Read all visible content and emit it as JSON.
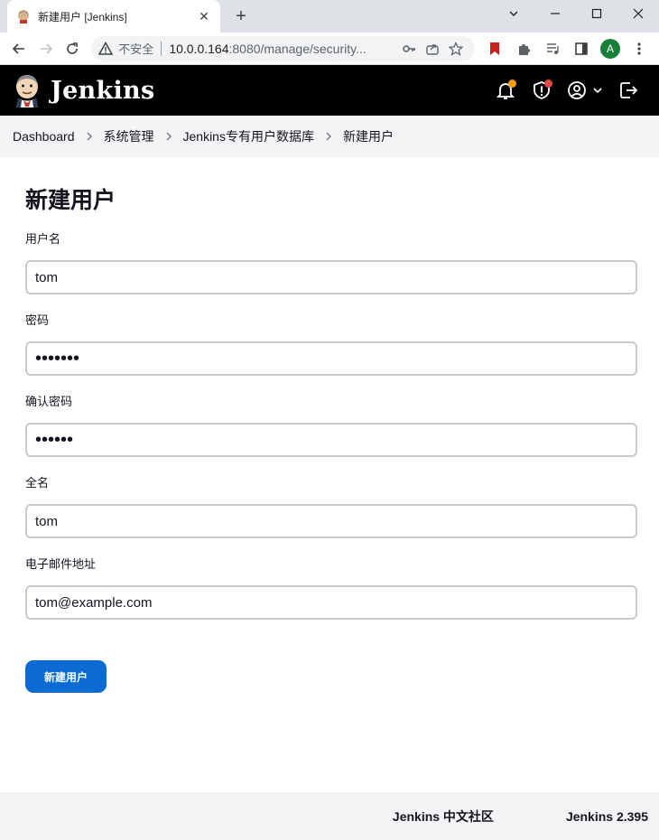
{
  "browser": {
    "tab_title": "新建用户 [Jenkins]",
    "insecure_label": "不安全",
    "url_host": "10.0.0.164",
    "url_rest": ":8080/manage/security...",
    "profile_initial": "A"
  },
  "header": {
    "brand": "Jenkins",
    "notification_dot_color": "#f59e0b",
    "security_dot_color": "#e5484d"
  },
  "breadcrumb": {
    "items": [
      "Dashboard",
      "系统管理",
      "Jenkins专有用户数据库",
      "新建用户"
    ]
  },
  "form": {
    "title": "新建用户",
    "fields": [
      {
        "label": "用户名",
        "value": "tom"
      },
      {
        "label": "密码",
        "value": "•••••••"
      },
      {
        "label": "确认密码",
        "value": "••••••"
      },
      {
        "label": "全名",
        "value": "tom"
      },
      {
        "label": "电子邮件地址",
        "value": "tom@example.com"
      }
    ],
    "submit_label": "新建用户"
  },
  "footer": {
    "community_link": "Jenkins 中文社区",
    "version": "Jenkins 2.395"
  }
}
